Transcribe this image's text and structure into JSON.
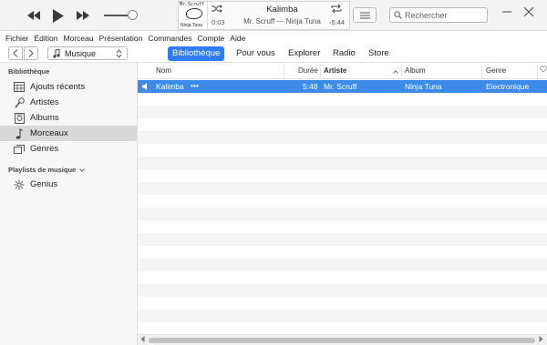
{
  "player": {
    "artwork": {
      "top_text": "Mr.Scruff",
      "bottom_text": "Ninja Tuna"
    },
    "now_playing": {
      "title": "Kalimba",
      "subtitle": "Mr. Scruff — Ninja Tuna",
      "elapsed": "0:03",
      "remaining": "-5:44"
    },
    "volume_level": 0.78,
    "search_placeholder": "Rechercher"
  },
  "menu": [
    "Fichier",
    "Édition",
    "Morceau",
    "Présentation",
    "Commandes",
    "Compte",
    "Aide"
  ],
  "toolbar": {
    "media_kind": "Musique",
    "tabs": [
      "Bibliothèque",
      "Pour vous",
      "Explorer",
      "Radio",
      "Store"
    ],
    "active_tab": "Bibliothèque"
  },
  "sidebar": {
    "library_header": "Bibliothèque",
    "library_items": [
      {
        "label": "Ajouts récents",
        "icon": "recently-added-icon"
      },
      {
        "label": "Artistes",
        "icon": "microphone-icon"
      },
      {
        "label": "Albums",
        "icon": "album-icon"
      },
      {
        "label": "Morceaux",
        "icon": "music-note-icon",
        "selected": true
      },
      {
        "label": "Genres",
        "icon": "genres-icon"
      }
    ],
    "playlists_header": "Playlists de musique",
    "playlist_items": [
      {
        "label": "Genius",
        "icon": "genius-icon"
      }
    ]
  },
  "table": {
    "columns": [
      "Nom",
      "Durée",
      "Artiste",
      "Album",
      "Genre"
    ],
    "sorted_column": "Artiste",
    "rows": [
      {
        "name": "Kalimba",
        "more": "•••",
        "duration": "5:48",
        "artist": "Mr. Scruff",
        "album": "Ninja Tuna",
        "genre": "Electronique",
        "playing": true
      }
    ]
  },
  "colors": {
    "accent": "#2f7cf6",
    "selected_row": "#3c8be8",
    "sidebar_bg": "#f7f7f7",
    "sidebar_selected": "#d9d9d9"
  }
}
